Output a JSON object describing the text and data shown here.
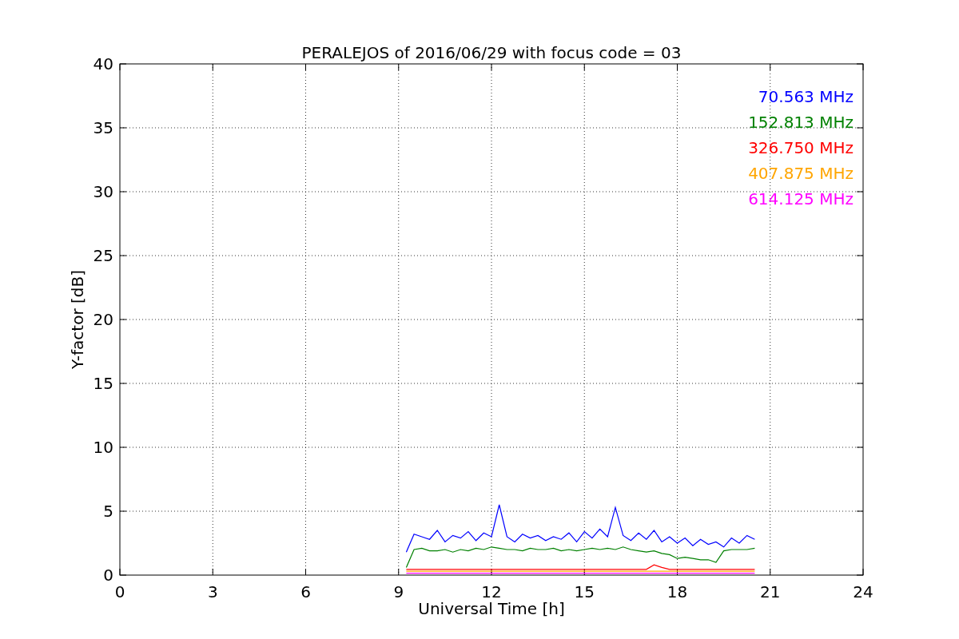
{
  "figure": {
    "chart_data": {
      "type": "line",
      "title": "PERALEJOS of 2016/06/29 with focus code = 03",
      "xlabel": "Universal Time [h]",
      "ylabel": "Y-factor [dB]",
      "x": [
        9.25,
        9.5,
        9.75,
        10,
        10.25,
        10.5,
        10.75,
        11,
        11.25,
        11.5,
        11.75,
        12,
        12.25,
        12.5,
        12.75,
        13,
        13.25,
        13.5,
        13.75,
        14,
        14.25,
        14.5,
        14.75,
        15,
        15.25,
        15.5,
        15.75,
        16,
        16.25,
        16.5,
        16.75,
        17,
        17.25,
        17.5,
        17.75,
        18,
        18.25,
        18.5,
        18.75,
        19,
        19.25,
        19.5,
        19.75,
        20,
        20.25,
        20.5
      ],
      "series": [
        {
          "name": "70.563 MHz",
          "color": "#0000ff",
          "values": [
            1.8,
            3.2,
            3.0,
            2.8,
            3.5,
            2.6,
            3.1,
            2.9,
            3.4,
            2.7,
            3.3,
            3.0,
            5.5,
            3.0,
            2.6,
            3.2,
            2.9,
            3.1,
            2.7,
            3.0,
            2.8,
            3.3,
            2.6,
            3.4,
            2.9,
            3.6,
            3.0,
            5.3,
            3.1,
            2.7,
            3.3,
            2.8,
            3.5,
            2.6,
            3.0,
            2.5,
            2.9,
            2.3,
            2.8,
            2.4,
            2.6,
            2.2,
            2.9,
            2.5,
            3.1,
            2.8
          ]
        },
        {
          "name": "152.813 MHz",
          "color": "#008000",
          "values": [
            0.6,
            2.0,
            2.1,
            1.9,
            1.9,
            2.0,
            1.8,
            2.0,
            1.9,
            2.1,
            2.0,
            2.2,
            2.1,
            2.0,
            2.0,
            1.9,
            2.1,
            2.0,
            2.0,
            2.1,
            1.9,
            2.0,
            1.9,
            2.0,
            2.1,
            2.0,
            2.1,
            2.0,
            2.2,
            2.0,
            1.9,
            1.8,
            1.9,
            1.7,
            1.6,
            1.3,
            1.4,
            1.3,
            1.2,
            1.2,
            1.0,
            1.9,
            2.0,
            2.0,
            2.0,
            2.1
          ]
        },
        {
          "name": "326.750 MHz",
          "color": "#ff0000",
          "values": [
            0.45,
            0.45,
            0.45,
            0.45,
            0.45,
            0.45,
            0.45,
            0.45,
            0.45,
            0.45,
            0.45,
            0.45,
            0.45,
            0.45,
            0.45,
            0.45,
            0.45,
            0.45,
            0.45,
            0.45,
            0.45,
            0.45,
            0.45,
            0.45,
            0.45,
            0.45,
            0.45,
            0.45,
            0.45,
            0.45,
            0.45,
            0.45,
            0.8,
            0.6,
            0.45,
            0.45,
            0.45,
            0.45,
            0.45,
            0.45,
            0.45,
            0.45,
            0.45,
            0.45,
            0.45,
            0.45
          ]
        },
        {
          "name": "407.875 MHz",
          "color": "#ffa500",
          "values": [
            0.3,
            0.3,
            0.3,
            0.3,
            0.3,
            0.3,
            0.3,
            0.3,
            0.3,
            0.3,
            0.3,
            0.3,
            0.3,
            0.3,
            0.3,
            0.3,
            0.3,
            0.3,
            0.3,
            0.3,
            0.3,
            0.3,
            0.3,
            0.3,
            0.3,
            0.3,
            0.3,
            0.3,
            0.3,
            0.3,
            0.3,
            0.3,
            0.3,
            0.3,
            0.3,
            0.3,
            0.3,
            0.3,
            0.3,
            0.3,
            0.3,
            0.3,
            0.3,
            0.3,
            0.3,
            0.3
          ]
        },
        {
          "name": "614.125 MHz",
          "color": "#ff00ff",
          "values": [
            0.15,
            0.15,
            0.15,
            0.15,
            0.15,
            0.15,
            0.15,
            0.15,
            0.15,
            0.15,
            0.15,
            0.15,
            0.15,
            0.15,
            0.15,
            0.15,
            0.15,
            0.15,
            0.15,
            0.15,
            0.15,
            0.15,
            0.15,
            0.15,
            0.15,
            0.15,
            0.15,
            0.15,
            0.15,
            0.15,
            0.15,
            0.15,
            0.15,
            0.15,
            0.15,
            0.15,
            0.15,
            0.15,
            0.15,
            0.15,
            0.15,
            0.15,
            0.15,
            0.15,
            0.15,
            0.15
          ]
        }
      ],
      "grid": true,
      "xlim": [
        0,
        24
      ],
      "ylim": [
        0,
        40
      ],
      "xticks": [
        0,
        3,
        6,
        9,
        12,
        15,
        18,
        21,
        24
      ],
      "yticks": [
        0,
        5,
        10,
        15,
        20,
        25,
        30,
        35,
        40
      ]
    }
  }
}
